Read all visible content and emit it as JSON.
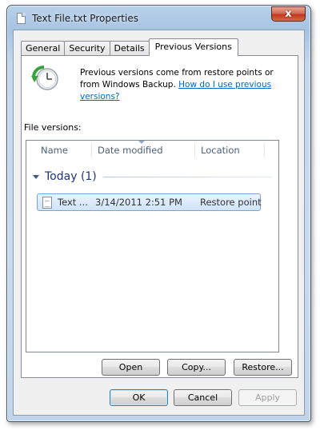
{
  "window": {
    "title": "Text File.txt Properties",
    "close_glyph": "x"
  },
  "tabs": [
    {
      "label": "General",
      "active": false
    },
    {
      "label": "Security",
      "active": false
    },
    {
      "label": "Details",
      "active": false
    },
    {
      "label": "Previous Versions",
      "active": true
    }
  ],
  "info": {
    "text": "Previous versions come from restore points or from Windows Backup.",
    "link": "How do I use previous versions?"
  },
  "file_versions_label": "File versions:",
  "columns": [
    "Name",
    "Date modified",
    "Location"
  ],
  "group": {
    "title": "Today (1)"
  },
  "rows": [
    {
      "name": "Text ...",
      "date": "3/14/2011 2:51 PM",
      "location": "Restore point",
      "selected": true
    }
  ],
  "buttons": {
    "open": "Open",
    "copy": "Copy...",
    "restore": "Restore...",
    "ok": "OK",
    "cancel": "Cancel",
    "apply": "Apply"
  },
  "colors": {
    "link": "#0066cc",
    "group_title": "#1e3287",
    "column_header": "#4c607a",
    "selection_border": "#7da2ce",
    "close_button": "#c0381f"
  },
  "icons": [
    "file-icon",
    "close-icon",
    "restore-clock-icon",
    "chevron-down-icon",
    "sort-arrow-icon",
    "text-file-icon"
  ]
}
